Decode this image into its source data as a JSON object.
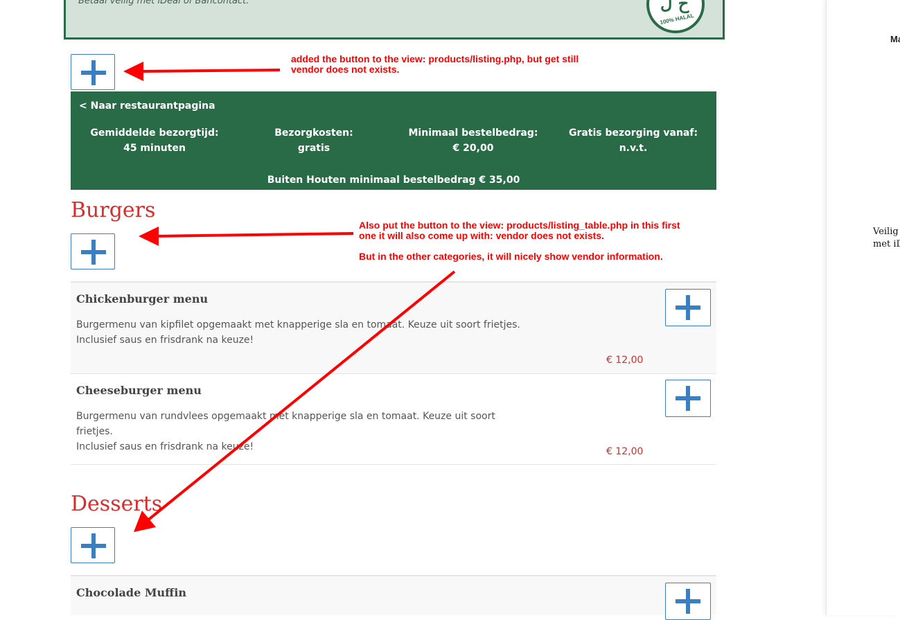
{
  "banner": {
    "text": "Betaal veilig met iDeal of Bancontact.",
    "logo_text": "100% HALAL"
  },
  "annotations": {
    "first": [
      "added the button to the view: products/listing.php, but get still",
      "vendor does not exists."
    ],
    "second": [
      "Also put the button to the view: products/listing_table.php in this first",
      "one it will also come up with: vendor does not exists."
    ],
    "third": "But in the other categories, it will nicely show vendor information."
  },
  "info": {
    "back_link": "<  Naar restaurantpagina",
    "stats": [
      {
        "label": "Gemiddelde bezorgtijd:",
        "value": "45 minuten"
      },
      {
        "label": "Bezorgkosten:",
        "value": "gratis"
      },
      {
        "label": "Minimaal bestelbedrag:",
        "value": "€ 20,00"
      },
      {
        "label": "Gratis bezorging vanaf:",
        "value": "n.v.t."
      }
    ],
    "min_order_outside": "Buiten Houten minimaal bestelbedrag € 35,00"
  },
  "categories": [
    {
      "title": "Burgers",
      "products": [
        {
          "name": "Chickenburger menu",
          "desc1": "Burgermenu van kipfilet opgemaakt met knapperige sla en tomaat. Keuze uit soort frietjes.",
          "desc2": "Inclusief saus en frisdrank na keuze!",
          "price": "€ 12,00"
        },
        {
          "name": "Cheeseburger menu",
          "desc1": "Burgermenu van rundvlees opgemaakt met knapperige sla en tomaat. Keuze uit soort frietjes.",
          "desc2": "Inclusief saus en frisdrank na keuze!",
          "price": "€ 12,00"
        }
      ]
    },
    {
      "title": "Desserts",
      "products": [
        {
          "name": "Chocolade Muffin",
          "desc1": "",
          "desc2": "",
          "price": ""
        }
      ]
    }
  ],
  "side": {
    "ma": "Ma",
    "veilig_line1": "Veilig",
    "veilig_line2": "met iD"
  },
  "colors": {
    "green": "#2a6b47",
    "red": "#d62d2d",
    "blue": "#3a7fc1",
    "annotation_red": "#ff0000"
  }
}
